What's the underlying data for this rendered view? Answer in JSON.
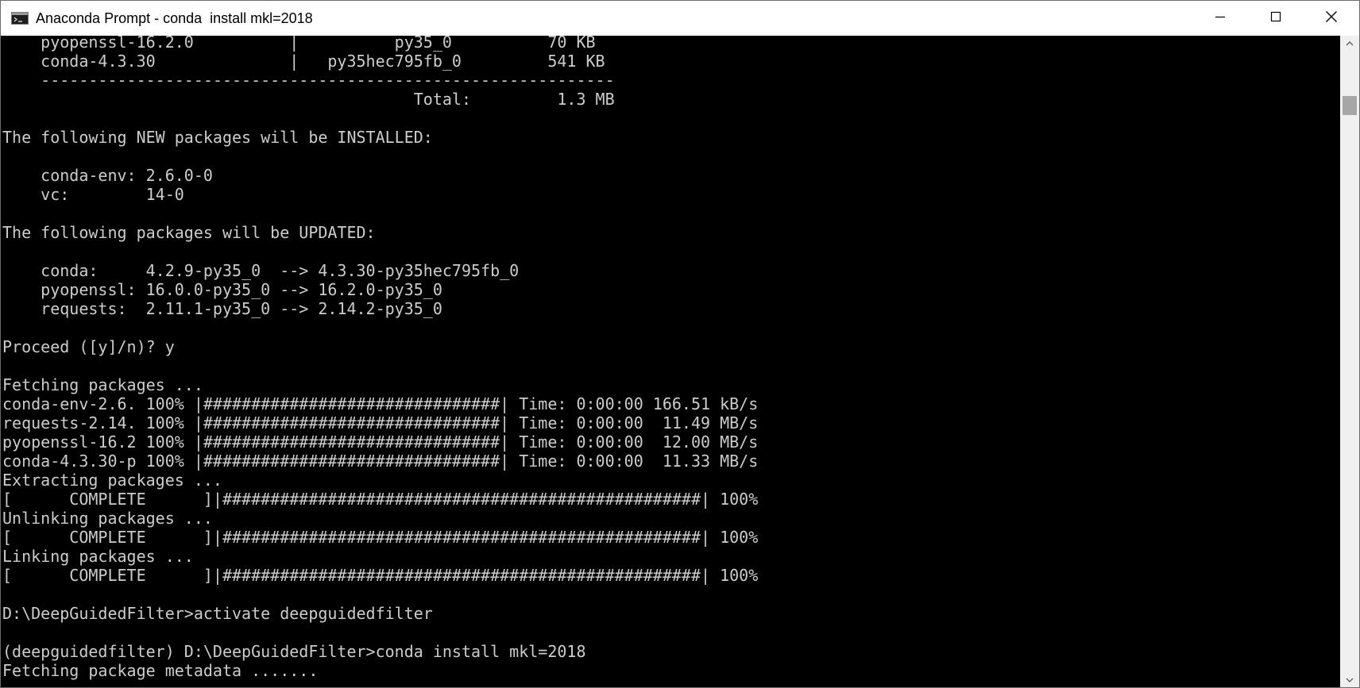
{
  "window": {
    "title": "Anaconda Prompt - conda  install mkl=2018"
  },
  "console": {
    "lines": [
      "    pyopenssl-16.2.0          |          py35_0          70 KB",
      "    conda-4.3.30              |   py35hec795fb_0         541 KB",
      "    ------------------------------------------------------------",
      "                                           Total:         1.3 MB",
      "",
      "The following NEW packages will be INSTALLED:",
      "",
      "    conda-env: 2.6.0-0",
      "    vc:        14-0",
      "",
      "The following packages will be UPDATED:",
      "",
      "    conda:     4.2.9-py35_0  --> 4.3.30-py35hec795fb_0",
      "    pyopenssl: 16.0.0-py35_0 --> 16.2.0-py35_0",
      "    requests:  2.11.1-py35_0 --> 2.14.2-py35_0",
      "",
      "Proceed ([y]/n)? y",
      "",
      "Fetching packages ...",
      "conda-env-2.6. 100% |###############################| Time: 0:00:00 166.51 kB/s",
      "requests-2.14. 100% |###############################| Time: 0:00:00  11.49 MB/s",
      "pyopenssl-16.2 100% |###############################| Time: 0:00:00  12.00 MB/s",
      "conda-4.3.30-p 100% |###############################| Time: 0:00:00  11.33 MB/s",
      "Extracting packages ...",
      "[      COMPLETE      ]|##################################################| 100%",
      "Unlinking packages ...",
      "[      COMPLETE      ]|##################################################| 100%",
      "Linking packages ...",
      "[      COMPLETE      ]|##################################################| 100%",
      "",
      "D:\\DeepGuidedFilter>activate deepguidedfilter",
      "",
      "(deepguidedfilter) D:\\DeepGuidedFilter>conda install mkl=2018",
      "Fetching package metadata ......."
    ]
  },
  "icons": {
    "app": "terminal-icon",
    "minimize": "minimize-icon",
    "maximize": "maximize-icon",
    "close": "close-icon",
    "scroll_up": "chevron-up-icon",
    "scroll_down": "chevron-down-icon"
  },
  "colors": {
    "console_bg": "#000000",
    "console_text": "#cccccc",
    "titlebar_bg": "#ffffff"
  }
}
